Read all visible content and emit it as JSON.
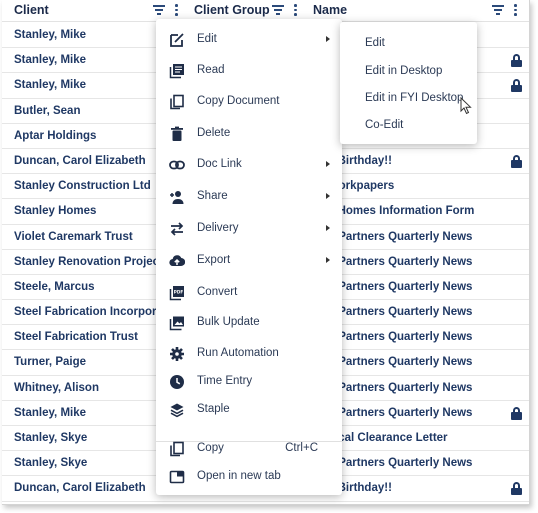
{
  "header": {
    "client": "Client",
    "client_group": "Client Group",
    "name": "Name"
  },
  "rows": [
    {
      "client": "Stanley, Mike",
      "name": "",
      "locked": false
    },
    {
      "client": "Stanley, Mike",
      "name": "",
      "locked": true
    },
    {
      "client": "Stanley, Mike",
      "name": "",
      "locked": true
    },
    {
      "client": "Butler, Sean",
      "name": "",
      "locked": false
    },
    {
      "client": "Aptar Holdings",
      "name": "",
      "locked": false
    },
    {
      "client": "Duncan, Carol Elizabeth",
      "name": "y Birthday!!",
      "locked": true
    },
    {
      "client": "Stanley Construction Ltd",
      "name": "Workpapers",
      "locked": false
    },
    {
      "client": "Stanley Homes",
      "name": "y Homes Information Form",
      "locked": false
    },
    {
      "client": "Violet Caremark Trust",
      "name": "h Partners Quarterly News",
      "locked": false
    },
    {
      "client": "Stanley Renovation Projects",
      "name": "h Partners Quarterly News",
      "locked": false
    },
    {
      "client": "Steele, Marcus",
      "name": "h Partners Quarterly News",
      "locked": false
    },
    {
      "client": "Steel Fabrication Incorporated",
      "name": "h Partners Quarterly News",
      "locked": false
    },
    {
      "client": "Steel Fabrication Trust",
      "name": "h Partners Quarterly News",
      "locked": false
    },
    {
      "client": "Turner, Paige",
      "name": "h Partners Quarterly News",
      "locked": false
    },
    {
      "client": "Whitney, Alison",
      "name": "h Partners Quarterly News",
      "locked": false
    },
    {
      "client": "Stanley, Mike",
      "name": "h Partners Quarterly News",
      "locked": true
    },
    {
      "client": "Stanley, Skye",
      "name": "hical Clearance Letter",
      "locked": false
    },
    {
      "client": "Stanley, Skye",
      "name": "h Partners Quarterly News",
      "locked": false
    },
    {
      "client": "Duncan, Carol Elizabeth",
      "name": "y Birthday!!",
      "locked": true
    }
  ],
  "menu": {
    "items": [
      {
        "label": "Edit",
        "icon": "edit-icon",
        "submenu": true
      },
      {
        "label": "Read",
        "icon": "read-icon",
        "submenu": false
      },
      {
        "label": "Copy Document",
        "icon": "copy-document-icon",
        "submenu": false
      },
      {
        "label": "Delete",
        "icon": "trash-icon",
        "submenu": false
      },
      {
        "label": "Doc Link",
        "icon": "link-icon",
        "submenu": true
      },
      {
        "label": "Share",
        "icon": "share-user-icon",
        "submenu": true
      },
      {
        "label": "Delivery",
        "icon": "swap-arrows-icon",
        "submenu": true
      },
      {
        "label": "Export",
        "icon": "cloud-upload-icon",
        "submenu": true
      },
      {
        "label": "Convert",
        "icon": "pdf-icon",
        "submenu": false
      },
      {
        "label": "Bulk Update",
        "icon": "gallery-icon",
        "submenu": false
      },
      {
        "label": "Run Automation",
        "icon": "gear-icon",
        "submenu": false
      },
      {
        "label": "Time Entry",
        "icon": "clock-icon",
        "submenu": false
      },
      {
        "label": "Staple",
        "icon": "layers-icon",
        "submenu": false
      }
    ],
    "copy": {
      "label": "Copy",
      "shortcut": "Ctrl+C",
      "icon": "copy-icon"
    },
    "open_new_tab": {
      "label": "Open in new tab",
      "icon": "open-new-tab-icon"
    }
  },
  "submenu": {
    "items": [
      "Edit",
      "Edit in Desktop",
      "Edit in FYI Desktop",
      "Co-Edit"
    ]
  },
  "colors": {
    "text_primary": "#1f3864",
    "menu_text": "#2b3a55",
    "icon": "#1f2d47"
  }
}
